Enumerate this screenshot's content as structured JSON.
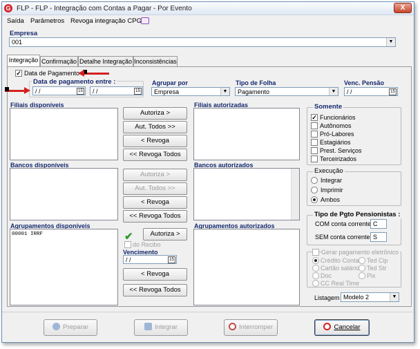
{
  "window": {
    "title": "FLP - FLP - Integração com Contas a Pagar - Por Evento",
    "close_label": "X"
  },
  "menu": [
    {
      "label": "Saída"
    },
    {
      "label": "Parâmetros"
    },
    {
      "label": "Revoga integração CPG"
    }
  ],
  "empresa": {
    "label": "Empresa",
    "value": "001"
  },
  "tabs": [
    {
      "label": "Integração"
    },
    {
      "label": "Confirmação"
    },
    {
      "label": "Detalhe Integração"
    },
    {
      "label": "Inconsistências"
    }
  ],
  "data_pagamento": {
    "check_label": "Data de Pagamento",
    "checked": true,
    "range_label": "Data de pagamento entre :",
    "from": "/ /",
    "to": "/ /"
  },
  "agrupar": {
    "label": "Agrupar por",
    "value": "Empresa"
  },
  "tipo_folha": {
    "label": "Tipo de Folha",
    "value": "Pagamento"
  },
  "venc_pensao": {
    "label": "Venc. Pensão",
    "value": "/ /"
  },
  "filiais": {
    "available_label": "Filiais disponíveis",
    "authorized_label": "Filiais autorizadas",
    "buttons": [
      "Autoriza >",
      "Aut. Todos >>",
      "< Revoga",
      "<< Revoga Todos"
    ]
  },
  "bancos": {
    "available_label": "Bancos disponíveis",
    "authorized_label": "Bancos autorizados",
    "buttons": [
      "Autoriza >",
      "Aut. Todos >>",
      "< Revoga",
      "<< Revoga Todos"
    ]
  },
  "agrupamentos": {
    "available_label": "Agrupamentos disponíveis",
    "authorized_label": "Agrupamentos autorizados",
    "items": [
      "00001 IRRF"
    ],
    "autoriza": "Autoriza >",
    "do_recibo": "do Recibo",
    "vencimento_label": "Vencimento",
    "vencimento_value": "/ /",
    "revoga": "< Revoga",
    "revoga_todos": "<< Revoga Todos"
  },
  "somente": {
    "title": "Somente",
    "options": [
      {
        "label": "Funcionários",
        "checked": true
      },
      {
        "label": "Autônomos",
        "checked": false
      },
      {
        "label": "Pró-Labores",
        "checked": false
      },
      {
        "label": "Estagiários",
        "checked": false
      },
      {
        "label": "Prest. Serviços",
        "checked": false
      },
      {
        "label": "Terceirizados",
        "checked": false
      }
    ]
  },
  "execucao": {
    "title": "Execução",
    "options": [
      {
        "label": "Integrar",
        "selected": false
      },
      {
        "label": "Imprimir",
        "selected": false
      },
      {
        "label": "Ambos",
        "selected": true
      }
    ]
  },
  "tipo_pgto": {
    "title": "Tipo de Pgto Pensionistas :",
    "com_label": "COM conta corrente",
    "com_value": "C",
    "sem_label": "SEM conta corrente",
    "sem_value": "S"
  },
  "gerar": {
    "title": "Gerar pagamento eletrônico",
    "options": [
      "Crédito Conta",
      "Ted Cip",
      "Cartão salário",
      "Ted Str",
      "Doc",
      "Pix",
      "CC Real Time"
    ]
  },
  "listagem": {
    "label": "Listagem",
    "value": "Modelo 2"
  },
  "bottom": {
    "preparar": "Preparar",
    "integrar": "Integrar",
    "interromper": "Interromper",
    "cancelar": "Cancelar"
  },
  "colors": {
    "accent_red": "#d42020",
    "label_blue": "#14286e",
    "check_green": "#2f9a2f"
  }
}
